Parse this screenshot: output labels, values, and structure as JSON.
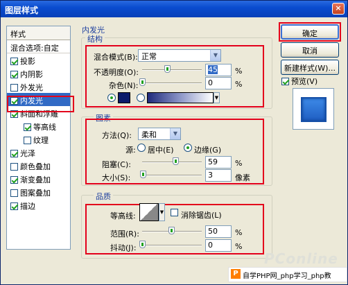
{
  "window": {
    "title": "图层样式",
    "close": "×"
  },
  "style_list": {
    "header": "样式",
    "items": [
      {
        "label": "混合选项:自定",
        "checked": null
      },
      {
        "label": "投影",
        "checked": true
      },
      {
        "label": "内阴影",
        "checked": true
      },
      {
        "label": "外发光",
        "checked": false
      },
      {
        "label": "内发光",
        "checked": true,
        "selected": true
      },
      {
        "label": "斜面和浮雕",
        "checked": true
      },
      {
        "label": "等高线",
        "checked": true,
        "sub": true
      },
      {
        "label": "纹理",
        "checked": false,
        "sub": true
      },
      {
        "label": "光泽",
        "checked": true
      },
      {
        "label": "颜色叠加",
        "checked": false
      },
      {
        "label": "渐变叠加",
        "checked": true
      },
      {
        "label": "图案叠加",
        "checked": false
      },
      {
        "label": "描边",
        "checked": true
      }
    ]
  },
  "panel": {
    "title": "内发光",
    "structure": {
      "legend": "结构",
      "blend_mode_label": "混合模式(B):",
      "blend_mode_value": "正常",
      "opacity_label": "不透明度(O):",
      "opacity_value": "45",
      "opacity_unit": "%",
      "noise_label": "杂色(N):",
      "noise_value": "0",
      "noise_unit": "%",
      "glow_color": "#0b1a6a"
    },
    "elements": {
      "legend": "图素",
      "method_label": "方法(Q):",
      "method_value": "柔和",
      "source_label": "源:",
      "source_center": "居中(E)",
      "source_edge": "边缘(G)",
      "choke_label": "阻塞(C):",
      "choke_value": "59",
      "choke_unit": "%",
      "size_label": "大小(S):",
      "size_value": "3",
      "size_unit": "像素"
    },
    "quality": {
      "legend": "品质",
      "contour_label": "等高线:",
      "antialias_label": "消除锯齿(L)",
      "range_label": "范围(R):",
      "range_value": "50",
      "range_unit": "%",
      "jitter_label": "抖动(J):",
      "jitter_value": "0",
      "jitter_unit": "%"
    }
  },
  "buttons": {
    "ok": "确定",
    "cancel": "取消",
    "new_style": "新建样式(W)...",
    "preview": "预览(V)"
  },
  "watermark": {
    "logo": "PConline",
    "badge": "P",
    "caption": "自学PHP网_php学习_php教"
  }
}
